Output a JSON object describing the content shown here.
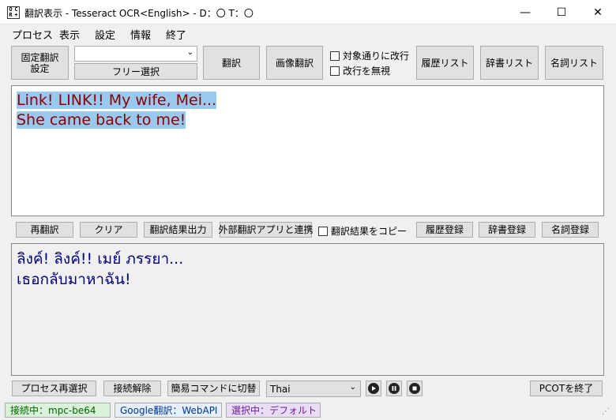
{
  "window": {
    "title": "翻訳表示 - Tesseract OCR<English> - D：〇 T：〇",
    "icon_glyphs": [
      "O",
      "C",
      "R",
      "+"
    ],
    "minimize": "—",
    "maximize": "☐",
    "close": "✕"
  },
  "menu": {
    "items": [
      "プロセス",
      "表示",
      "設定",
      "情報",
      "終了"
    ]
  },
  "toolbar": {
    "fixed_translation": "固定翻訳\n設定",
    "combo_value": "",
    "free_select": "フリー選択",
    "translate": "翻訳",
    "image_translate": "画像翻訳",
    "check_newline": "対象通りに改行",
    "check_ignore_newline": "改行を無視",
    "history_list": "履歴リスト",
    "dictionary_list": "辞書リスト",
    "noun_list": "名詞リスト"
  },
  "source": {
    "lines": [
      "Link! LINK!! My wife, Mei...",
      "She came back to me!"
    ],
    "text_color": "#8b0000",
    "selection_color": "#99c9ef"
  },
  "actions": {
    "retranslate": "再翻訳",
    "clear": "クリア",
    "output": "翻訳結果出力",
    "external": "外部翻訳アプリと連携",
    "copy_result": "翻訳結果をコピー",
    "history_register": "履歴登録",
    "dictionary_register": "辞書登録",
    "noun_register": "名詞登録"
  },
  "result": {
    "lines": [
      "ลิงค์! ลิงค์!! เมย์ ภรรยา...",
      "เธอกลับมาหาฉัน!"
    ],
    "text_color": "#000080"
  },
  "bottom": {
    "reselect_process": "プロセス再選択",
    "disconnect": "接続解除",
    "simple_command": "簡易コマンドに切替",
    "language": "Thai",
    "play_icon": "play-icon",
    "pause_icon": "pause-icon",
    "stop_icon": "stop-icon",
    "exit_pcot": "PCOTを終了"
  },
  "statusbar": {
    "connection": "接続中：mpc-be64",
    "engine": "Google翻訳：WebAPI",
    "selection": "選択中：デフォルト",
    "connection_color": "#d9f2d9",
    "engine_color": "#e6f0fb",
    "selection_color": "#e9dcf5"
  }
}
